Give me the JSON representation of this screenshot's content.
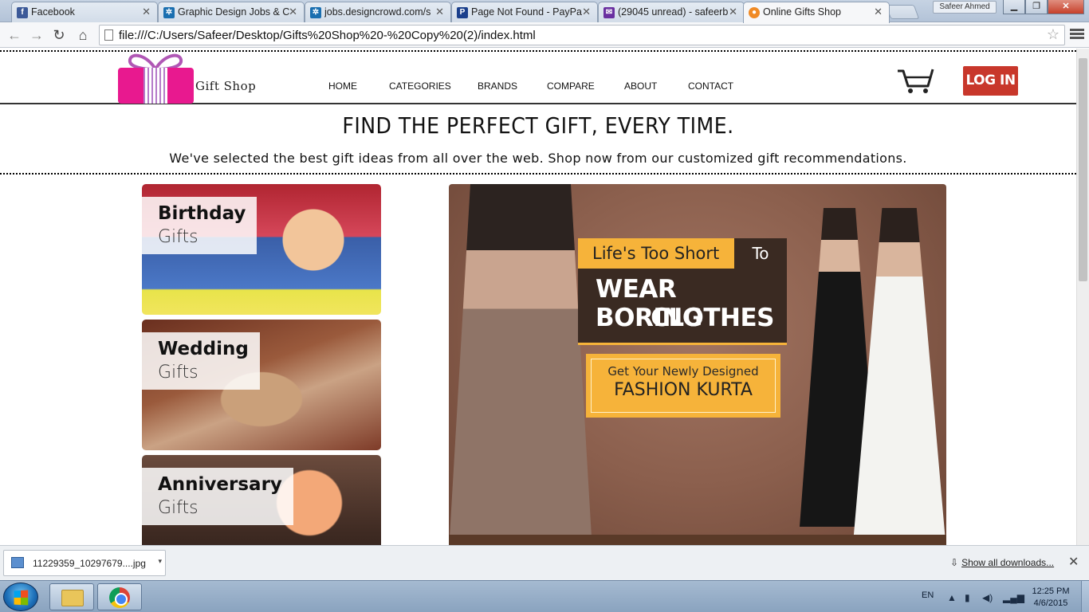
{
  "browser": {
    "tabs": [
      {
        "title": "Facebook",
        "favicon": "facebook-icon",
        "color": "#3b5998"
      },
      {
        "title": "Graphic Design Jobs & C",
        "favicon": "designcrowd-icon",
        "color": "#1a6fb0"
      },
      {
        "title": "jobs.designcrowd.com/s",
        "favicon": "designcrowd-icon",
        "color": "#1a6fb0"
      },
      {
        "title": "Page Not Found - PayPa",
        "favicon": "paypal-icon",
        "color": "#1a3f8c"
      },
      {
        "title": "(29045 unread) - safeerb",
        "favicon": "mail-icon",
        "color": "#6a2fa0"
      },
      {
        "title": "Online Gifts Shop",
        "favicon": "site-icon",
        "color": "#f08a24"
      }
    ],
    "profile": "Safeer Ahmed",
    "address": "file:///C:/Users/Safeer/Desktop/Gifts%20Shop%20-%20Copy%20(2)/index.html"
  },
  "site": {
    "logo_text": "Gift Shop",
    "nav": [
      "HOME",
      "CATEGORIES",
      "BRANDS",
      "COMPARE",
      "ABOUT",
      "CONTACT"
    ],
    "login_label": "LOG IN",
    "hero_title": "FIND THE PERFECT GIFT, EVERY TIME.",
    "hero_subtitle": "We've selected the best gift ideas from all over the web. Shop now from our customized gift recommendations.",
    "categories": [
      {
        "main": "Birthday",
        "sub": "Gifts"
      },
      {
        "main": "Wedding",
        "sub": "Gifts"
      },
      {
        "main": "Anniversary",
        "sub": "Gifts"
      }
    ],
    "banner": {
      "line_a": "Life's Too Short",
      "line_a_to": "To",
      "line_b1": "WEAR BORING",
      "line_b2": "CLOTHES",
      "cta_small": "Get Your Newly Designed",
      "cta_big": "FASHION KURTA"
    },
    "colors": {
      "accent": "#f6b33a",
      "login": "#c8372b",
      "logo_pink": "#e8198f",
      "banner_dark": "#3a2a22"
    }
  },
  "downloads": {
    "file": "11229359_10297679....jpg",
    "show_all": "Show all downloads..."
  },
  "taskbar": {
    "lang": "EN",
    "time": "12:25 PM",
    "date": "4/6/2015"
  }
}
